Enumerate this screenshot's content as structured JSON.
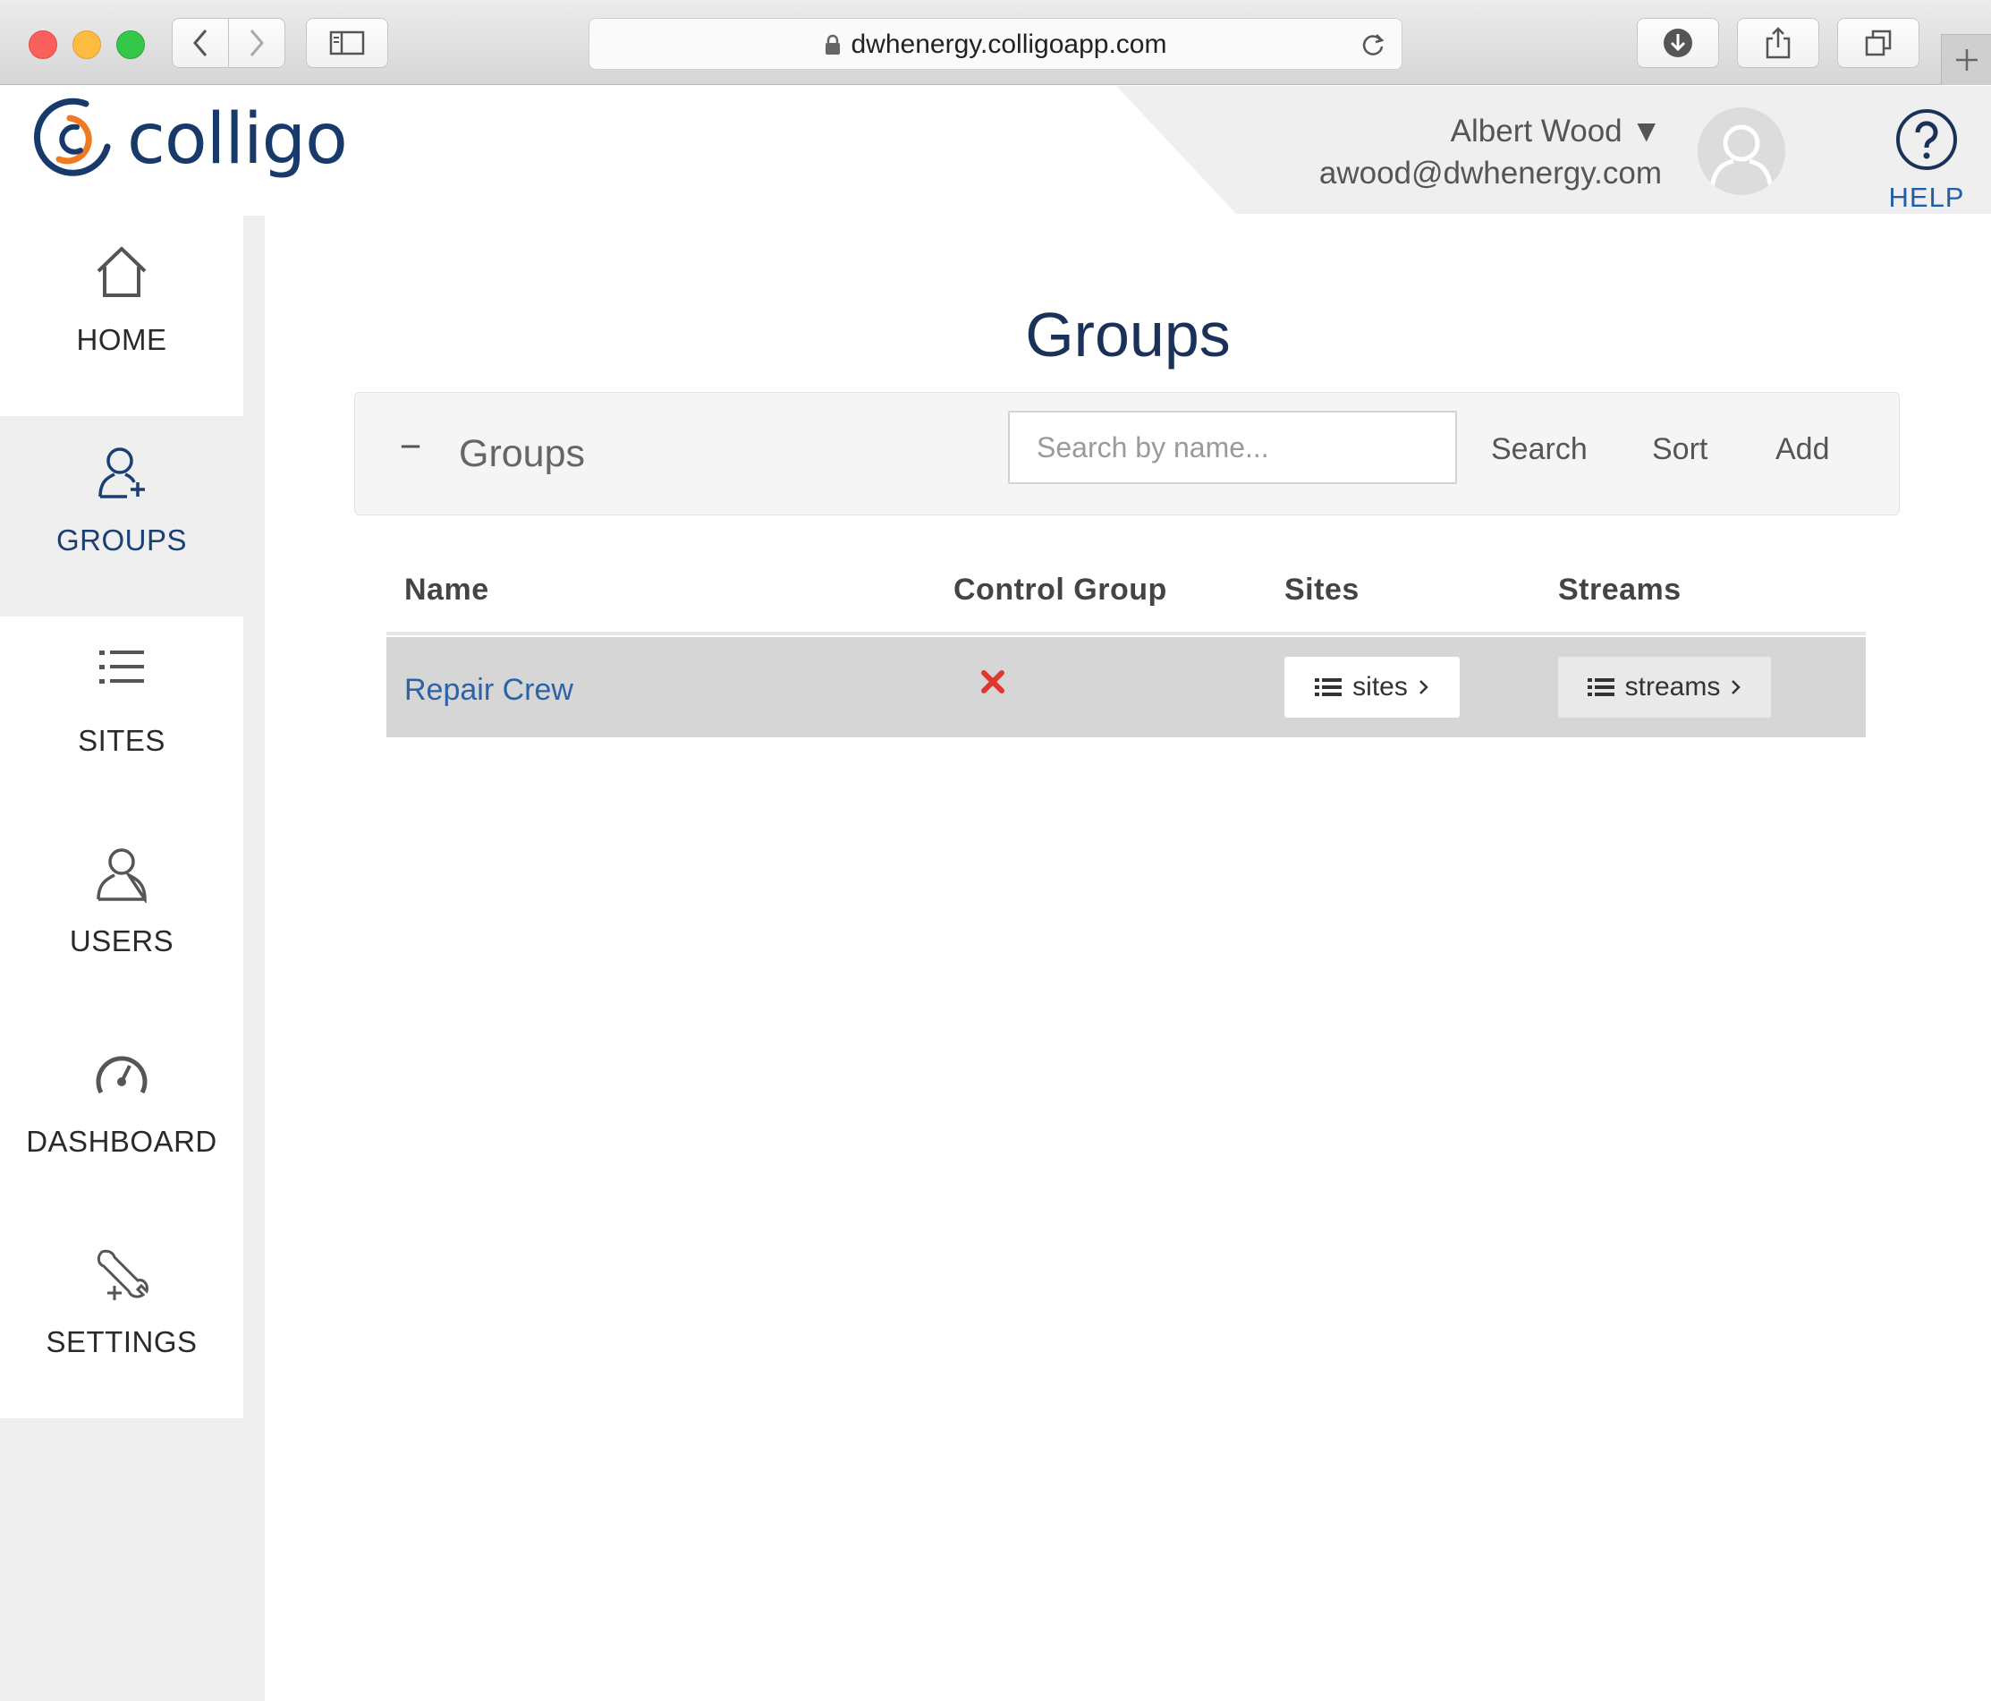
{
  "browser": {
    "url": "dwhenergy.colligoapp.com"
  },
  "header": {
    "logo_text": "colligo",
    "user_name": "Albert Wood ▼",
    "user_email": "awood@dwhenergy.com",
    "help_label": "HELP"
  },
  "sidebar": {
    "items": [
      {
        "label": "HOME",
        "icon": "home-icon",
        "active": false
      },
      {
        "label": "GROUPS",
        "icon": "user-add-icon",
        "active": true
      },
      {
        "label": "SITES",
        "icon": "list-icon",
        "active": false
      },
      {
        "label": "USERS",
        "icon": "user-icon",
        "active": false
      },
      {
        "label": "DASHBOARD",
        "icon": "gauge-icon",
        "active": false
      },
      {
        "label": "SETTINGS",
        "icon": "tools-icon",
        "active": false
      }
    ]
  },
  "main": {
    "title": "Groups",
    "panel": {
      "collapse_symbol": "−",
      "title": "Groups",
      "search_placeholder": "Search by name...",
      "search_label": "Search",
      "sort_label": "Sort",
      "add_label": "Add"
    },
    "table": {
      "columns": [
        "Name",
        "Control Group",
        "Sites",
        "Streams"
      ],
      "rows": [
        {
          "name": "Repair Crew",
          "control_group": false,
          "sites_button": "sites",
          "streams_button": "streams"
        }
      ]
    }
  },
  "colors": {
    "brand_navy": "#173a6b",
    "brand_orange": "#f07a22",
    "link_blue": "#2c62a8",
    "error_red": "#e0382f"
  }
}
